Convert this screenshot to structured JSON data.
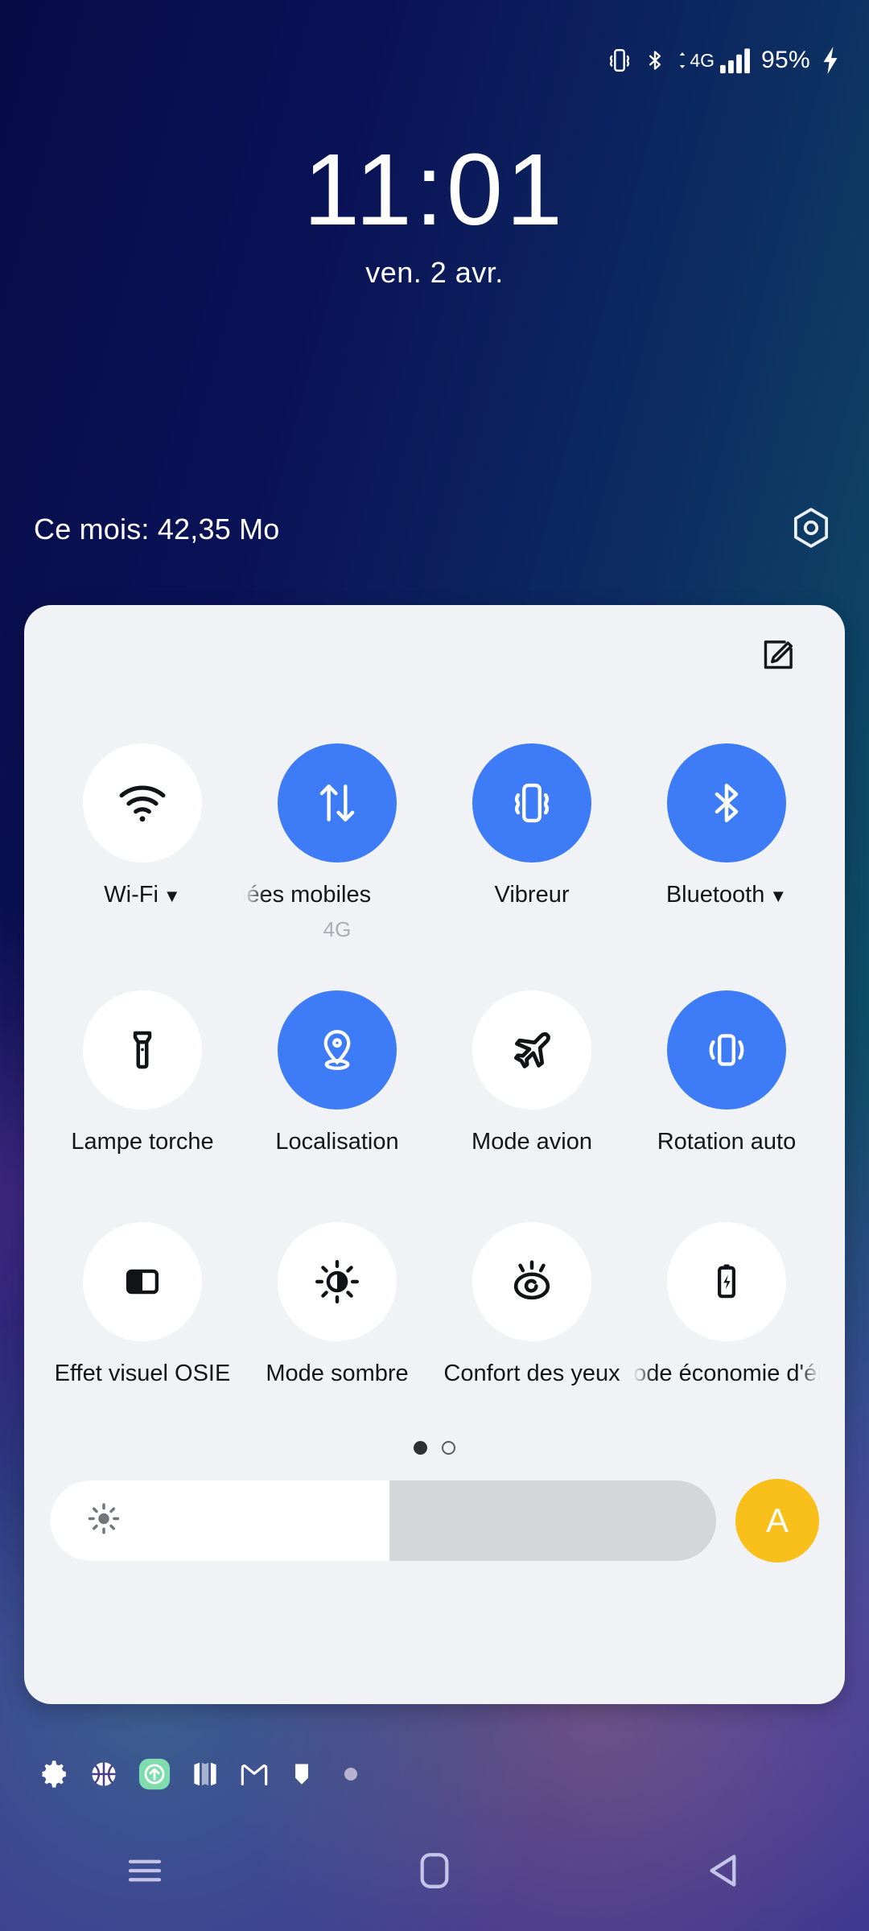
{
  "statusbar": {
    "icons": [
      "vibrate-icon",
      "bluetooth-icon",
      "mobile-data-4g-icon",
      "signal-bars-icon"
    ],
    "network_label": "4G",
    "battery_percent": "95%",
    "charging": true
  },
  "lockclock": {
    "time": "11:01",
    "date": "ven. 2 avr."
  },
  "datausage": {
    "label": "Ce mois: 42,35 Mo",
    "settings_icon": "hexagon-settings-icon"
  },
  "panel": {
    "edit_icon": "edit-pencil-square-icon",
    "rows": [
      [
        {
          "name": "wifi",
          "label": "Wi-Fi",
          "icon": "wifi-icon",
          "on": false,
          "has_caret": true,
          "sub": ""
        },
        {
          "name": "mobile-data",
          "label": "Données mobiles",
          "icon": "data-transfer-icon",
          "on": true,
          "has_caret": false,
          "sub": "4G",
          "marquee": true
        },
        {
          "name": "vibrate",
          "label": "Vibreur",
          "icon": "vibrate-icon",
          "on": true,
          "has_caret": false,
          "sub": ""
        },
        {
          "name": "bluetooth",
          "label": "Bluetooth",
          "icon": "bluetooth-icon",
          "on": true,
          "has_caret": true,
          "sub": ""
        }
      ],
      [
        {
          "name": "flashlight",
          "label": "Lampe torche",
          "icon": "flashlight-icon",
          "on": false,
          "has_caret": false,
          "sub": ""
        },
        {
          "name": "location",
          "label": "Localisation",
          "icon": "location-pin-icon",
          "on": true,
          "has_caret": false,
          "sub": ""
        },
        {
          "name": "airplane-mode",
          "label": "Mode avion",
          "icon": "airplane-icon",
          "on": false,
          "has_caret": false,
          "sub": ""
        },
        {
          "name": "auto-rotate",
          "label": "Rotation auto",
          "icon": "rotate-phone-icon",
          "on": true,
          "has_caret": false,
          "sub": ""
        }
      ],
      [
        {
          "name": "osie-visual",
          "label": "Effet visuel OSIE",
          "icon": "contrast-panel-icon",
          "on": false,
          "has_caret": false,
          "sub": ""
        },
        {
          "name": "dark-mode",
          "label": "Mode sombre",
          "icon": "brightness-half-icon",
          "on": false,
          "has_caret": false,
          "sub": ""
        },
        {
          "name": "eye-comfort",
          "label": "Confort des yeux",
          "icon": "eye-comfort-icon",
          "on": false,
          "has_caret": false,
          "sub": ""
        },
        {
          "name": "battery-saver",
          "label": "Mode économie d'énergie",
          "icon": "battery-saver-icon",
          "on": false,
          "has_caret": false,
          "sub": "",
          "marquee": true
        }
      ]
    ],
    "pager": {
      "count": 2,
      "active": 1
    },
    "brightness": {
      "icon": "brightness-sun-icon",
      "value_percent": 51,
      "auto_label": "A"
    },
    "accent_on_color": "#3d7bf7",
    "tile_off_color": "#ffffff",
    "panel_bg_color": "#f0f2f5",
    "auto_brightness_color": "#f9c01b"
  },
  "tray": {
    "icons": [
      "gear-icon",
      "basketball-icon",
      "upload-arrow-app-icon",
      "maps-icon",
      "gmail-icon",
      "shield-bookmark-icon"
    ],
    "overflow_dot": "more-notifications-dot"
  },
  "navbar": {
    "recents_label": "recents-icon",
    "home_label": "home-icon",
    "back_label": "back-icon"
  }
}
